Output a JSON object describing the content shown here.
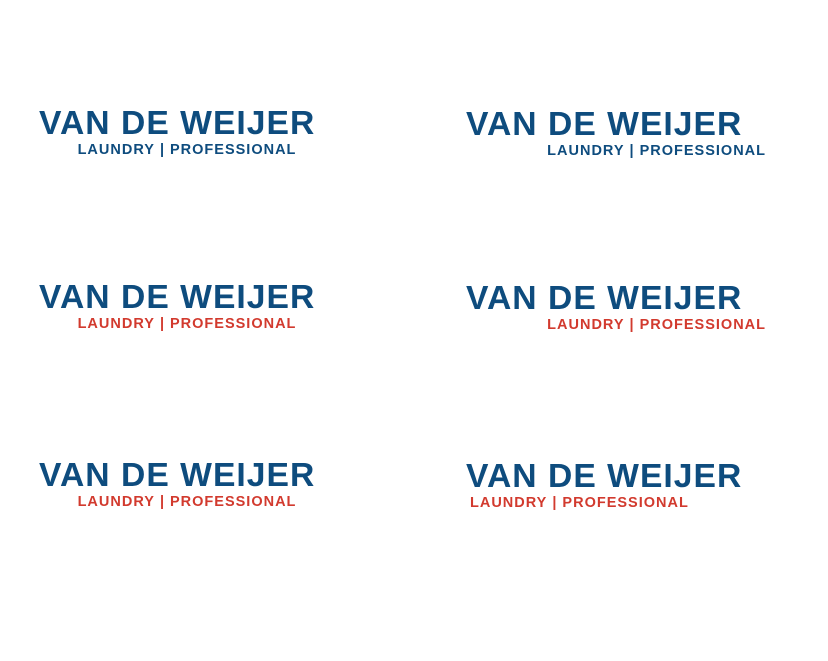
{
  "colors": {
    "brand_blue": "#0e4c7e",
    "brand_red": "#d23a2e",
    "background": "#ffffff"
  },
  "logos": [
    {
      "title": "VAN DE WEIJER",
      "tagline_left": "LAUNDRY",
      "separator": "|",
      "tagline_right": "PROFESSIONAL",
      "tagline_color": "#0e4c7e",
      "tagline_align": "center"
    },
    {
      "title": "VAN DE WEIJER",
      "tagline_left": "LAUNDRY",
      "separator": "|",
      "tagline_right": "PROFESSIONAL",
      "tagline_color": "#0e4c7e",
      "tagline_align": "right"
    },
    {
      "title": "VAN DE WEIJER",
      "tagline_left": "LAUNDRY",
      "separator": "|",
      "tagline_right": "PROFESSIONAL",
      "tagline_color": "#d23a2e",
      "tagline_align": "center"
    },
    {
      "title": "VAN DE WEIJER",
      "tagline_left": "LAUNDRY",
      "separator": "|",
      "tagline_right": "PROFESSIONAL",
      "tagline_color": "#d23a2e",
      "tagline_align": "right"
    },
    {
      "title": "VAN DE WEIJER",
      "tagline_left": "LAUNDRY",
      "separator": "|",
      "tagline_right": "PROFESSIONAL",
      "tagline_color": "#d23a2e",
      "tagline_align": "center"
    },
    {
      "title": "VAN DE WEIJER",
      "tagline_left": "LAUNDRY",
      "separator": "|",
      "tagline_right": "PROFESSIONAL",
      "tagline_color": "#d23a2e",
      "tagline_align": "left"
    }
  ]
}
